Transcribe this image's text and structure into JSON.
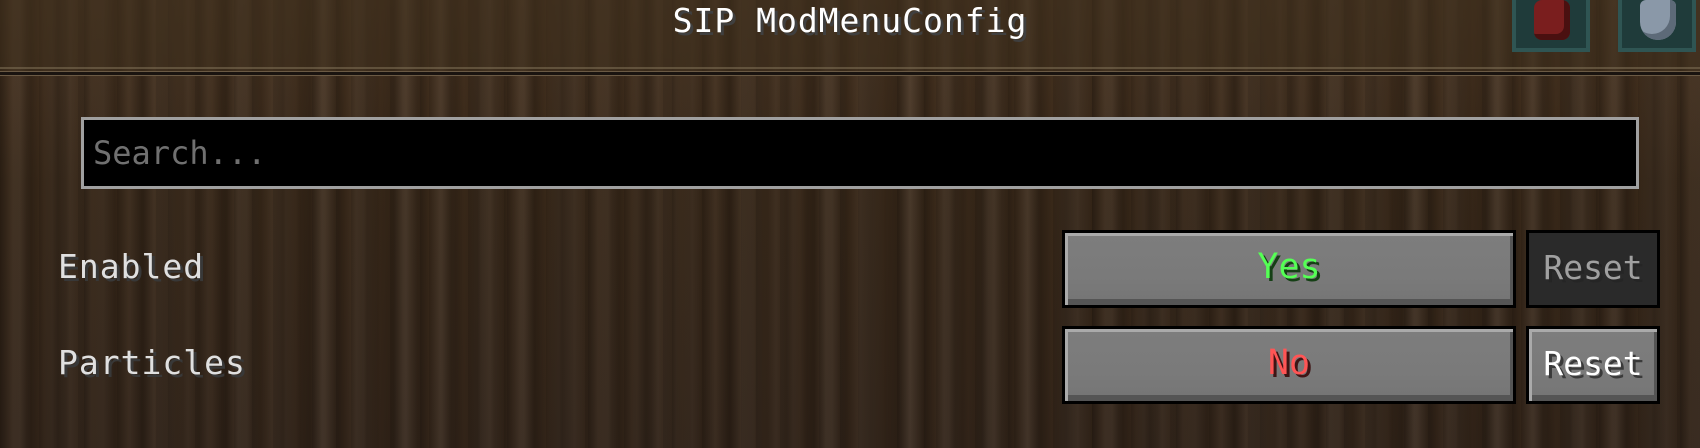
{
  "header": {
    "title": "SIP ModMenuConfig"
  },
  "corner_slots": [
    {
      "icon": "red-item-icon"
    },
    {
      "icon": "shield-item-icon"
    }
  ],
  "search": {
    "placeholder": "Search...",
    "value": ""
  },
  "options": [
    {
      "label": "Enabled",
      "value": "Yes",
      "value_color": "#55ff55",
      "reset_label": "Reset",
      "reset_enabled": false
    },
    {
      "label": "Particles",
      "value": "No",
      "value_color": "#ff5555",
      "reset_label": "Reset",
      "reset_enabled": true
    }
  ],
  "colors": {
    "yes": "#55ff55",
    "no": "#ff5555",
    "title": "#ffffff",
    "label": "#e0e0e0"
  }
}
